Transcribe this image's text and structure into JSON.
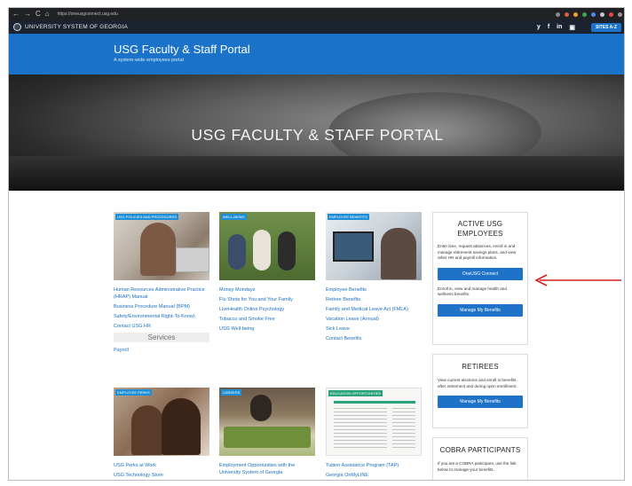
{
  "browser": {
    "url": "https://oneusgconnect.usg.edu",
    "nav_icons": [
      "←",
      "→",
      "C",
      "⌂"
    ]
  },
  "usg_bar": {
    "system_name": "UNIVERSITY SYSTEM OF GEORGIA",
    "social": [
      "y",
      "f",
      "in",
      "▣"
    ],
    "button": "SITES A-Z"
  },
  "header": {
    "title": "USG Faculty & Staff Portal",
    "subtitle": "A system-wide employees portal"
  },
  "hero": {
    "title": "USG FACULTY & STAFF PORTAL"
  },
  "cards": {
    "policies": {
      "tag": "USG POLICIES AND PROCEDURES",
      "links": [
        "Human Resources Administrative Practice (HRAP) Manual",
        "Business Procedure Manual (BPM)",
        "Safety/Environmental Right-To-Know)",
        "Contact USG HR"
      ],
      "services_label": "Services",
      "services_links": [
        "Payroll"
      ]
    },
    "wellbeing": {
      "tag": "WELL-BEING",
      "links": [
        "Money Mondays",
        "Flu Shots for You and Your Family",
        "LiveHealth Online Psychology",
        "Tobacco and Smoke Free",
        "USG Well-being"
      ]
    },
    "benefits": {
      "tag": "EMPLOYEE BENEFITS",
      "links": [
        "Employee Benefits",
        "Retiree Benefits",
        "Family and Medical Leave Act (FMLA)",
        "Vacation Leave (Annual)",
        "Sick Leave",
        "Contact Benefits"
      ]
    },
    "perks": {
      "tag": "EMPLOYEE PERKS",
      "links": [
        "USG Perks at Work",
        "USG Technology Store"
      ]
    },
    "careers": {
      "tag": "CAREERS",
      "links": [
        "Employment Opportunities with the University System of Georgia"
      ]
    },
    "education": {
      "tag": "EDUCATION OPPORTUNITIES",
      "links": [
        "Tuition Assistance Program (TAP)",
        "Georgia OnMyLINE"
      ]
    }
  },
  "sidebar": {
    "active": {
      "title": "ACTIVE USG EMPLOYEES",
      "text1": "Enter time, request absences, enroll in and manage retirement savings plans, and view other HR and payroll information.",
      "button1": "OneUSG Connect",
      "text2": "Enroll in, view and manage health and wellness benefits.",
      "button2": "Manage My Benefits"
    },
    "retirees": {
      "title": "RETIREES",
      "text": "View current elections and enroll in benefits after retirement and during open enrollment.",
      "button": "Manage My Benefits"
    },
    "cobra": {
      "title": "COBRA PARTICIPANTS",
      "text": "If you are a COBRA participant, use the link below to manage your benefits."
    }
  },
  "colors": {
    "brand_blue": "#1b73c9",
    "link_blue": "#1b6fc0",
    "arrow_red": "#d42020"
  }
}
